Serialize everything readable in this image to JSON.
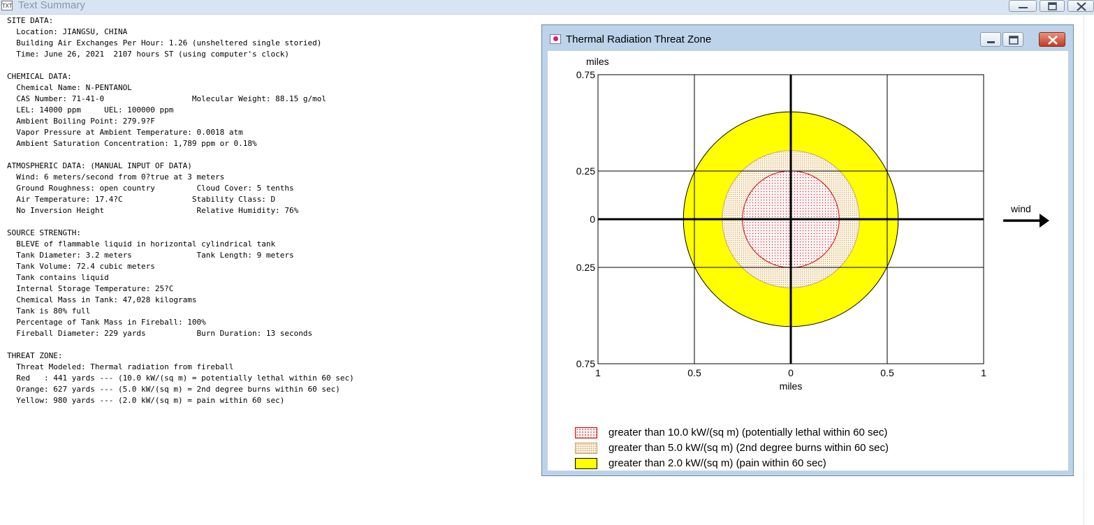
{
  "window": {
    "title": "Text Summary",
    "icon_text": "TXT"
  },
  "report_lines": [
    "SITE DATA:",
    "  Location: JIANGSU, CHINA",
    "  Building Air Exchanges Per Hour: 1.26 (unsheltered single storied)",
    "  Time: June 26, 2021  2107 hours ST (using computer's clock)",
    "",
    "CHEMICAL DATA:",
    "  Chemical Name: N-PENTANOL",
    "  CAS Number: 71-41-0                   Molecular Weight: 88.15 g/mol",
    "  LEL: 14000 ppm     UEL: 100000 ppm",
    "  Ambient Boiling Point: 279.9?F",
    "  Vapor Pressure at Ambient Temperature: 0.0018 atm",
    "  Ambient Saturation Concentration: 1,789 ppm or 0.18%",
    "",
    "ATMOSPHERIC DATA: (MANUAL INPUT OF DATA)",
    "  Wind: 6 meters/second from 0?true at 3 meters",
    "  Ground Roughness: open country         Cloud Cover: 5 tenths",
    "  Air Temperature: 17.4?C               Stability Class: D",
    "  No Inversion Height                    Relative Humidity: 76%",
    "",
    "SOURCE STRENGTH:",
    "  BLEVE of flammable liquid in horizontal cylindrical tank",
    "  Tank Diameter: 3.2 meters              Tank Length: 9 meters",
    "  Tank Volume: 72.4 cubic meters",
    "  Tank contains liquid",
    "  Internal Storage Temperature: 25?C",
    "  Chemical Mass in Tank: 47,028 kilograms",
    "  Tank is 80% full",
    "  Percentage of Tank Mass in Fireball: 100%",
    "  Fireball Diameter: 229 yards           Burn Duration: 13 seconds",
    "",
    "THREAT ZONE:",
    "  Threat Modeled: Thermal radiation from fireball",
    "  Red   : 441 yards --- (10.0 kW/(sq m) = potentially lethal within 60 sec)",
    "  Orange: 627 yards --- (5.0 kW/(sq m) = 2nd degree burns within 60 sec)",
    "  Yellow: 980 yards --- (2.0 kW/(sq m) = pain within 60 sec)"
  ],
  "threat_window": {
    "title": "Thermal Radiation Threat Zone"
  },
  "chart_data": {
    "type": "area",
    "units_label_top": "miles",
    "xlabel": "miles",
    "xlim": [
      -1,
      1
    ],
    "ylim": [
      -0.75,
      0.75
    ],
    "x_ticks": [
      {
        "value": -1,
        "label": "1"
      },
      {
        "value": -0.5,
        "label": "0.5"
      },
      {
        "value": 0,
        "label": "0"
      },
      {
        "value": 0.5,
        "label": "0.5"
      },
      {
        "value": 1,
        "label": "1"
      }
    ],
    "y_ticks": [
      {
        "value": 0.75,
        "label": "0.75"
      },
      {
        "value": 0.25,
        "label": "0.25"
      },
      {
        "value": 0,
        "label": "0"
      },
      {
        "value": -0.25,
        "label": "0.25"
      },
      {
        "value": -0.75,
        "label": "0.75"
      }
    ],
    "zones": [
      {
        "name": "greater than 2.0 kW/(sq m) (pain within 60 sec)",
        "radius_miles": 0.557,
        "fill": "#ffff00",
        "stroke": "#000000",
        "pattern": "solid"
      },
      {
        "name": "greater than 5.0 kW/(sq m) (2nd degree burns within 60 sec)",
        "radius_miles": 0.356,
        "fill": "#f4e6c9",
        "stroke": "#c9a46a",
        "pattern": "dots-tan"
      },
      {
        "name": "greater than 10.0 kW/(sq m) (potentially lethal within 60 sec)",
        "radius_miles": 0.251,
        "fill": "#fbe3e3",
        "stroke": "#c80000",
        "pattern": "dots-red"
      }
    ],
    "wind_label": "wind",
    "wind_direction": "east"
  },
  "legend": {
    "items": [
      {
        "label": "greater than 10.0 kW/(sq m) (potentially lethal within 60 sec)",
        "pattern": "dots-red"
      },
      {
        "label": "greater than 5.0 kW/(sq m) (2nd degree burns within 60 sec)",
        "pattern": "dots-tan"
      },
      {
        "label": "greater than 2.0 kW/(sq m) (pain within 60 sec)",
        "pattern": "solid"
      }
    ]
  }
}
